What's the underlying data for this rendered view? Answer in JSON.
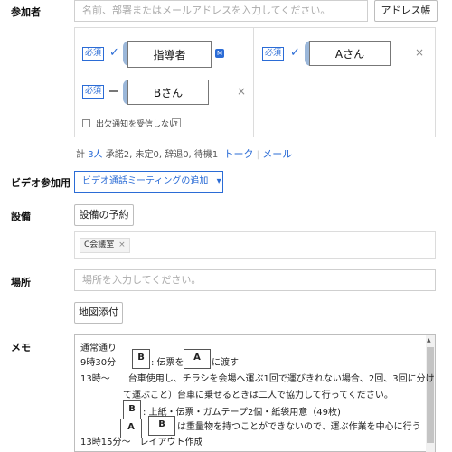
{
  "participants": {
    "label": "参加者",
    "search_placeholder": "名前、部署またはメールアドレスを入力してください。",
    "address_book": "アドレス帳",
    "required_tag": "必須",
    "attendees": [
      {
        "name": "指導者",
        "status": "check",
        "badge": "M"
      },
      {
        "name": "Aさん",
        "status": "check"
      },
      {
        "name": "Bさん",
        "status": "dash"
      }
    ],
    "no_attendance_notice": "出欠通知を受信しない",
    "help": "?",
    "summary_prefix": "計",
    "summary_count": "3人",
    "summary_rest": "承諾2, 未定0, 辞退0, 待機1",
    "talk_link": "トーク",
    "separator": "|",
    "mail_link": "メール",
    "remove_symbol": "×"
  },
  "video": {
    "label": "ビデオ参加用",
    "add_button": "ビデオ通話ミーティングの追加",
    "caret": "▾"
  },
  "equipment": {
    "label": "設備",
    "reserve_button": "設備の予約",
    "tag": "C会議室",
    "tag_remove": "×"
  },
  "location": {
    "label": "場所",
    "placeholder": "場所を入力してください。",
    "map_button": "地図添付"
  },
  "memo": {
    "label": "メモ",
    "line1": "通常通り",
    "line2_a": "9時30分",
    "line2_b": "B",
    "line2_c": ": 伝票を",
    "line2_d": "A",
    "line2_e": "に渡す",
    "line3": "13時～　　台車使用し、チラシを会場へ運ぶ1回で運びきれない場合、2回、3回に分け",
    "line4": "て運ぶこと）台車に乗せるときは二人で協力して行ってください。",
    "line5_box": "B",
    "line5": ": 上紙・伝票・ガムテープ2個・紙袋用意（49枚)",
    "line6_box_a": "A",
    "line6_box_b": "B",
    "line6": "は重量物を持つことができないので、運ぶ作業を中心に行う",
    "line7": "13時15分～　レイアウト作成"
  },
  "colors": {
    "accent": "#2b6cd6",
    "border": "#cfcfcf"
  }
}
